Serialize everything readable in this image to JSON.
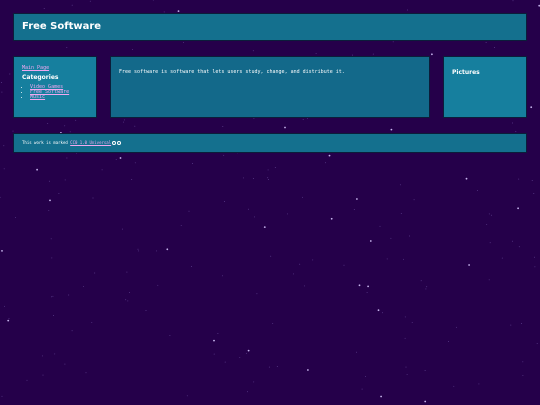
{
  "header": {
    "title": "Free Software"
  },
  "left_sidebar": {
    "main_link": "Main Page",
    "categories_title": "Categories",
    "categories": [
      "Video Games",
      "Free Software",
      "Music"
    ]
  },
  "content": {
    "intro": "Free software is software that lets users study, change, and distribute it."
  },
  "right_sidebar": {
    "title": "Pictures"
  },
  "footer": {
    "prefix": "This work is marked ",
    "license_link": "CC0 1.0 Universal",
    "icons": [
      "cc-icon",
      "zero-icon"
    ]
  },
  "colors": {
    "background": "#25004a",
    "panel": "#14708e",
    "link": "#f0a8f0",
    "text": "#ffffff"
  }
}
